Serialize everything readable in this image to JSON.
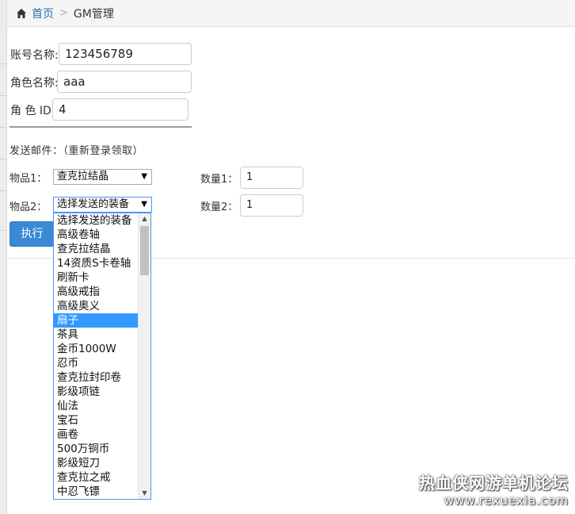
{
  "breadcrumb": {
    "home_icon": "home-icon",
    "home_label": "首页",
    "separator": ">",
    "current_label": "GM管理"
  },
  "form": {
    "account_label": "账号名称:",
    "account_value": "123456789",
    "role_name_label": "角色名称:",
    "role_name_value": "aaa",
    "role_id_label": "角 色 ID:",
    "role_id_value": "4",
    "mail_section_title": "发送邮件：（重新登录领取）",
    "item1_label": "物品1：",
    "item1_selected": "查克拉结晶",
    "qty1_label": "数量1：",
    "qty1_value": "1",
    "item2_label": "物品2：",
    "item2_selected": "选择发送的装备",
    "qty2_label": "数量2：",
    "qty2_value": "1",
    "execute_label": "执行"
  },
  "dropdown": {
    "highlighted": "扇子",
    "options": [
      "选择发送的装备",
      "高级卷轴",
      "查克拉结晶",
      "14资质S卡卷轴",
      "刷新卡",
      "高级戒指",
      "高级奥义",
      "扇子",
      "茶具",
      "金币1000W",
      "忍币",
      "查克拉封印卷",
      "影级项链",
      "仙法",
      "宝石",
      "画卷",
      "500万铜币",
      "影级短刀",
      "查克拉之戒",
      "中忍飞镖"
    ]
  },
  "watermark": {
    "title": "热血侠网游单机论坛",
    "url": "www.rexuexia.com"
  }
}
